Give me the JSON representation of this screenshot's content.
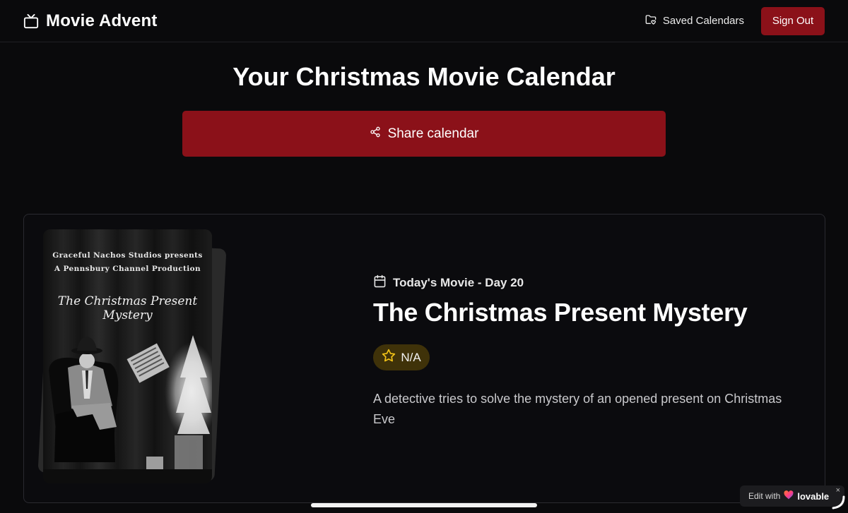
{
  "app": {
    "brand_name": "Movie Advent",
    "brand_icon": "tv-icon"
  },
  "nav": {
    "saved_calendars_label": "Saved Calendars",
    "saved_calendars_icon": "folder-heart-icon",
    "sign_out_label": "Sign Out"
  },
  "page": {
    "heading": "Your Christmas Movie Calendar",
    "share_label": "Share calendar",
    "share_icon": "share-icon"
  },
  "movie": {
    "day_label": "Today's Movie - Day 20",
    "day_icon": "calendar-icon",
    "title": "The Christmas Present Mystery",
    "rating": "N/A",
    "rating_icon": "star-icon",
    "description": "A detective tries to solve the mystery of an opened present on Christmas Eve",
    "poster": {
      "line1": "Graceful Nachos Studios presents",
      "line2": "A Pennsbury Channel Production",
      "title": "The Christmas Present Mystery"
    }
  },
  "badge": {
    "prefix": "Edit with",
    "brand": "lovable",
    "close": "×"
  },
  "colors": {
    "background": "#0a0a0c",
    "accent_red": "#8b1119",
    "rating_bg": "#3f3209",
    "star": "#f2c318"
  }
}
